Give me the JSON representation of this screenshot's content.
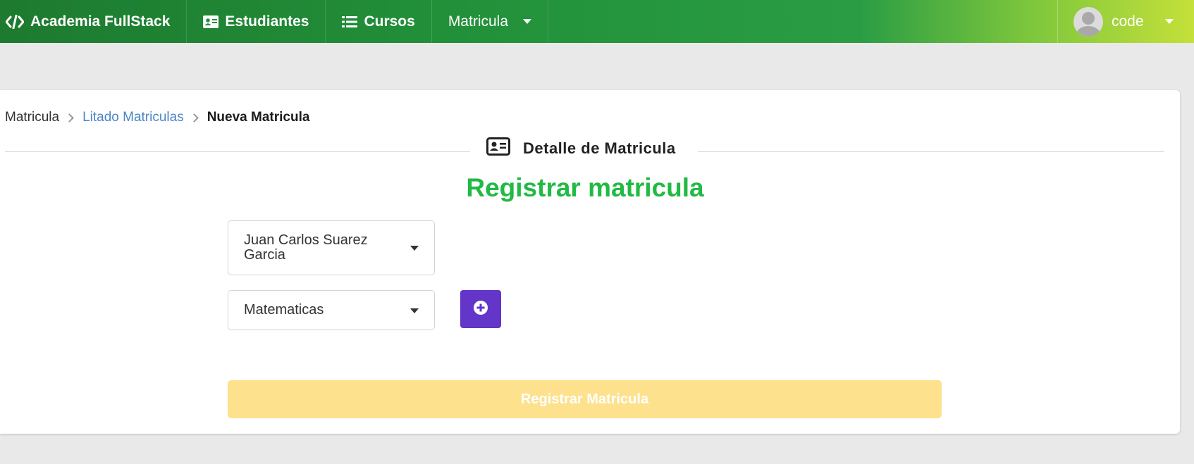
{
  "navbar": {
    "brand": "Academia FullStack",
    "items": [
      {
        "label": "Estudiantes",
        "icon": "id-card-icon"
      },
      {
        "label": "Cursos",
        "icon": "list-icon"
      },
      {
        "label": "Matricula",
        "icon": "chevron-down-icon"
      }
    ],
    "user": {
      "name": "code"
    }
  },
  "breadcrumb": {
    "root": "Matricula",
    "link": "Litado Matriculas",
    "active": "Nueva Matricula"
  },
  "section": {
    "title": "Detalle de Matricula",
    "icon": "id-card-icon"
  },
  "form": {
    "heading": "Registrar matricula",
    "student_select": {
      "value_line1": "Juan Carlos Suarez",
      "value_line2": "Garcia"
    },
    "course_select": {
      "value": "Matematicas"
    },
    "add_button_icon": "plus-circle-icon",
    "submit_label": "Registrar Matricula"
  },
  "colors": {
    "nav_gradient_start": "#1d7a2f",
    "nav_gradient_end": "#c4e03a",
    "heading_green": "#21ba45",
    "link_blue": "#4a86c5",
    "add_button_purple": "#6435c9",
    "submit_disabled_yellow": "#fde18d"
  }
}
